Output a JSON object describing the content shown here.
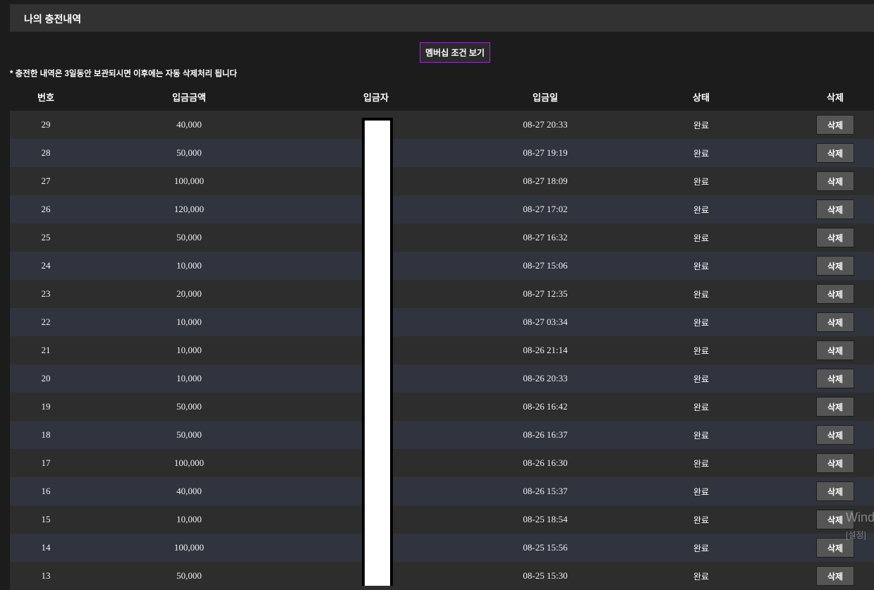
{
  "header": {
    "title": "나의 충전내역"
  },
  "membership_button": "멤버십 조건 보기",
  "notice": "* 충전한 내역은 3일동안 보관되시면 이후에는 자동 삭제처리 됩니다",
  "table": {
    "columns": [
      "번호",
      "입금금액",
      "입금자",
      "입금일",
      "상태",
      "삭제"
    ],
    "delete_label": "삭제",
    "rows": [
      {
        "no": "29",
        "amount": "40,000",
        "depositor": "",
        "date": "08-27 20:33",
        "status": "완료"
      },
      {
        "no": "28",
        "amount": "50,000",
        "depositor": "",
        "date": "08-27 19:19",
        "status": "완료"
      },
      {
        "no": "27",
        "amount": "100,000",
        "depositor": "",
        "date": "08-27 18:09",
        "status": "완료"
      },
      {
        "no": "26",
        "amount": "120,000",
        "depositor": "",
        "date": "08-27 17:02",
        "status": "완료"
      },
      {
        "no": "25",
        "amount": "50,000",
        "depositor": "",
        "date": "08-27 16:32",
        "status": "완료"
      },
      {
        "no": "24",
        "amount": "10,000",
        "depositor": "",
        "date": "08-27 15:06",
        "status": "완료"
      },
      {
        "no": "23",
        "amount": "20,000",
        "depositor": "",
        "date": "08-27 12:35",
        "status": "완료"
      },
      {
        "no": "22",
        "amount": "10,000",
        "depositor": "",
        "date": "08-27 03:34",
        "status": "완료"
      },
      {
        "no": "21",
        "amount": "10,000",
        "depositor": "",
        "date": "08-26 21:14",
        "status": "완료"
      },
      {
        "no": "20",
        "amount": "10,000",
        "depositor": "",
        "date": "08-26 20:33",
        "status": "완료"
      },
      {
        "no": "19",
        "amount": "50,000",
        "depositor": "",
        "date": "08-26 16:42",
        "status": "완료"
      },
      {
        "no": "18",
        "amount": "50,000",
        "depositor": "",
        "date": "08-26 16:37",
        "status": "완료"
      },
      {
        "no": "17",
        "amount": "100,000",
        "depositor": "",
        "date": "08-26 16:30",
        "status": "완료"
      },
      {
        "no": "16",
        "amount": "40,000",
        "depositor": "",
        "date": "08-26 15:37",
        "status": "완료"
      },
      {
        "no": "15",
        "amount": "10,000",
        "depositor": "",
        "date": "08-25 18:54",
        "status": "완료"
      },
      {
        "no": "14",
        "amount": "100,000",
        "depositor": "",
        "date": "08-25 15:56",
        "status": "완료"
      },
      {
        "no": "13",
        "amount": "50,000",
        "depositor": "",
        "date": "08-25 15:30",
        "status": "완료"
      }
    ]
  },
  "watermark": {
    "line1": "Wind",
    "line2": "[설정]"
  },
  "colors": {
    "accent_border": "#9a2fc4",
    "row_odd": "#2d2d2d",
    "row_even": "#30343e"
  }
}
